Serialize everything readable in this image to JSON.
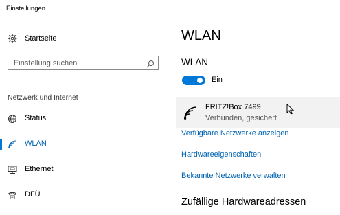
{
  "app": {
    "title": "Einstellungen"
  },
  "sidebar": {
    "home_label": "Startseite",
    "search": {
      "placeholder": "Einstellung suchen",
      "value": ""
    },
    "section_header": "Netzwerk und Internet",
    "items": [
      {
        "label": "Status",
        "icon": "globe-icon"
      },
      {
        "label": "WLAN",
        "icon": "wifi-icon",
        "selected": true
      },
      {
        "label": "Ethernet",
        "icon": "ethernet-icon"
      },
      {
        "label": "DFÜ",
        "icon": "dialup-icon"
      }
    ]
  },
  "main": {
    "title": "WLAN",
    "wifi_heading": "WLAN",
    "toggle": {
      "state": true,
      "label": "Ein"
    },
    "network": {
      "name": "FRITZ!Box 7499",
      "status": "Verbunden, gesichert",
      "icon": "wifi-signal-icon"
    },
    "links": [
      "Verfügbare Netzwerke anzeigen",
      "Hardwareeigenschaften",
      "Bekannte Netzwerke verwalten"
    ],
    "section_title": "Zufällige Hardwareadressen"
  },
  "colors": {
    "accent": "#0078d7",
    "link": "#0063b1",
    "card_bg": "#f2f2f2"
  }
}
